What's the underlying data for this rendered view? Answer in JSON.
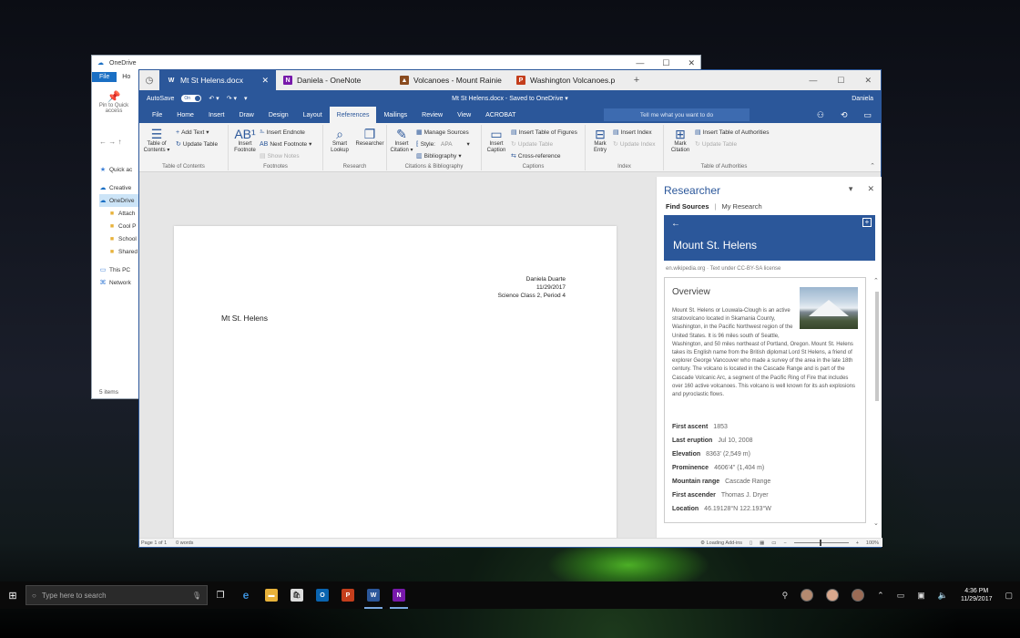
{
  "explorer": {
    "title": "OneDrive",
    "file_tab": "File",
    "home_tab": "Ho",
    "pin_label": "Pin to Quick access",
    "tree": [
      {
        "label": "Quick ac",
        "icon": "star-icon",
        "sub": false,
        "selected": false
      },
      {
        "label": "Creative",
        "icon": "cloud-icon",
        "sub": false,
        "selected": false
      },
      {
        "label": "OneDrive",
        "icon": "cloud-icon",
        "sub": false,
        "selected": true
      },
      {
        "label": "Attach",
        "icon": "folder-icon",
        "sub": true,
        "selected": false
      },
      {
        "label": "Cool P",
        "icon": "folder-icon",
        "sub": true,
        "selected": false
      },
      {
        "label": "School",
        "icon": "folder-icon",
        "sub": true,
        "selected": false
      },
      {
        "label": "Shared",
        "icon": "folder-icon",
        "sub": true,
        "selected": false
      },
      {
        "label": "This PC",
        "icon": "pc-icon",
        "sub": false,
        "selected": false
      },
      {
        "label": "Network",
        "icon": "network-icon",
        "sub": false,
        "selected": false
      }
    ],
    "status": "5 items"
  },
  "browser_tabs": [
    {
      "label": "Mt St Helens.docx",
      "icon": "W",
      "color": "#2b579a",
      "active": true
    },
    {
      "label": "Daniela - OneNote",
      "icon": "N",
      "color": "#7719aa",
      "active": false
    },
    {
      "label": "Volcanoes - Mount Rainie",
      "icon": "▲",
      "color": "#8a4b1e",
      "active": false
    },
    {
      "label": "Washington Volcanoes.p",
      "icon": "P",
      "color": "#c43e1c",
      "active": false
    }
  ],
  "titlebar": {
    "autosave": "AutoSave",
    "toggle": "On",
    "doc_title": "Mt St Helens.docx - Saved to OneDrive",
    "user": "Daniela"
  },
  "menu": [
    "File",
    "Home",
    "Insert",
    "Draw",
    "Design",
    "Layout",
    "References",
    "Mailings",
    "Review",
    "View",
    "ACROBAT"
  ],
  "menu_active": "References",
  "tell_me": "Tell me what you want to do",
  "ribbon": {
    "toc": {
      "big": "Table of Contents",
      "add_text": "Add Text",
      "update": "Update Table",
      "group": "Table of Contents"
    },
    "footnotes": {
      "big": "Insert Footnote",
      "endnote": "Insert Endnote",
      "next": "Next Footnote",
      "show": "Show Notes",
      "group": "Footnotes"
    },
    "research": {
      "smart": "Smart Lookup",
      "researcher": "Researcher",
      "group": "Research"
    },
    "citations": {
      "big": "Insert Citation",
      "manage": "Manage Sources",
      "style_label": "Style:",
      "style_value": "APA",
      "biblio": "Bibliography",
      "group": "Citations & Bibliography"
    },
    "captions": {
      "big": "Insert Caption",
      "tof": "Insert Table of Figures",
      "update": "Update Table",
      "cross": "Cross-reference",
      "group": "Captions"
    },
    "index": {
      "big": "Mark Entry",
      "insert": "Insert Index",
      "update": "Update Index",
      "group": "Index"
    },
    "authorities": {
      "big": "Mark Citation",
      "insert": "Insert Table of Authorities",
      "update": "Update Table",
      "group": "Table of Authorities"
    }
  },
  "document": {
    "header_lines": [
      "Daniela Duarte",
      "11/29/2017",
      "Science Class 2, Period 4"
    ],
    "heading": "Mt St. Helens"
  },
  "researcher": {
    "title": "Researcher",
    "tabs": [
      "Find Sources",
      "My Research"
    ],
    "topic": "Mount St. Helens",
    "source": "en.wikipedia.org  ·  Text under CC-BY-SA license",
    "overview_title": "Overview",
    "overview_text": "Mount St. Helens or Louwala-Clough is an active stratovolcano located in Skamania County, Washington, in the Pacific Northwest region of the United States. It is 96 miles south of Seattle, Washington, and 50 miles northeast of Portland, Oregon. Mount St. Helens takes its English name from the British diplomat Lord St Helens, a friend of explorer George Vancouver who made a survey of the area in the late 18th century. The volcano is located in the Cascade Range and is part of the Cascade Volcanic Arc, a segment of the Pacific Ring of Fire that includes over 160 active volcanoes. This volcano is well known for its ash explosions and pyroclastic flows.",
    "facts": [
      {
        "k": "First ascent",
        "v": "1853"
      },
      {
        "k": "Last eruption",
        "v": "Jul 10, 2008"
      },
      {
        "k": "Elevation",
        "v": "8363' (2,549 m)"
      },
      {
        "k": "Prominence",
        "v": "4606'4\" (1,404 m)"
      },
      {
        "k": "Mountain range",
        "v": "Cascade Range"
      },
      {
        "k": "First ascender",
        "v": "Thomas J. Dryer"
      },
      {
        "k": "Location",
        "v": "46.19128°N 122.193°W"
      }
    ]
  },
  "statusbar": {
    "page": "Page 1 of 1",
    "words": "0 words",
    "addins": "Loading Add-ins",
    "zoom": "100%"
  },
  "taskbar": {
    "search_placeholder": "Type here to search",
    "time": "4:36 PM",
    "date": "11/29/2017"
  }
}
